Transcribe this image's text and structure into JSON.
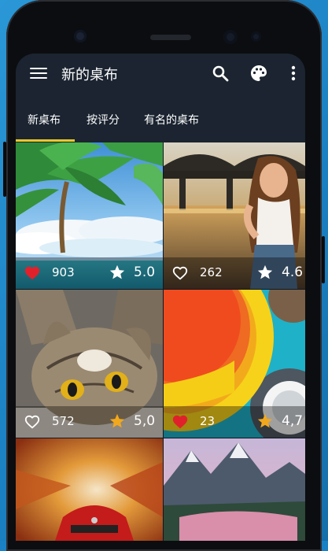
{
  "app": {
    "title": "新的桌布"
  },
  "toolbar": {
    "menu_icon": "menu-icon",
    "search_icon": "search-icon",
    "palette_icon": "palette-icon",
    "more_icon": "more-vert-icon"
  },
  "tabs": [
    {
      "label": "新桌布",
      "active": true
    },
    {
      "label": "按评分",
      "active": false
    },
    {
      "label": "有名的桌布",
      "active": false
    }
  ],
  "colors": {
    "accent": "#e8c72b",
    "liked": "#e0212b",
    "star_gold": "#f2a81d",
    "appbar": "#1b2430"
  },
  "wallpapers": [
    {
      "subject": "palm-beach",
      "likes": "903",
      "liked": true,
      "rating": "5.0",
      "star_gold": false
    },
    {
      "subject": "woman-bridge-sunset",
      "likes": "262",
      "liked": false,
      "rating": "4.6",
      "star_gold": false
    },
    {
      "subject": "cat",
      "likes": "572",
      "liked": false,
      "rating": "5,0",
      "star_gold": true
    },
    {
      "subject": "material-circles",
      "likes": "23",
      "liked": true,
      "rating": "4,7",
      "star_gold": true
    },
    {
      "subject": "red-car-autumn",
      "likes": "",
      "liked": false,
      "rating": "",
      "star_gold": false
    },
    {
      "subject": "mountain-lake",
      "likes": "",
      "liked": false,
      "rating": "",
      "star_gold": false
    }
  ]
}
